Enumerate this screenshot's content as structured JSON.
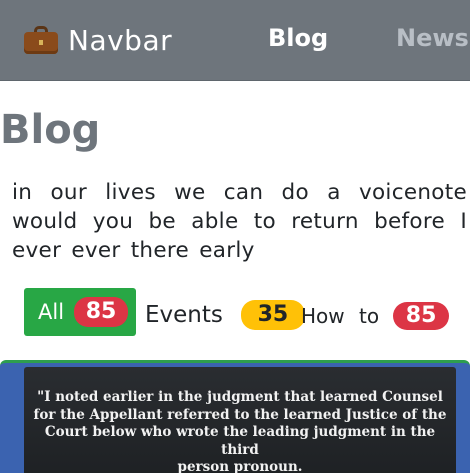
{
  "navbar": {
    "brand_icon": "briefcase-icon",
    "brand": "Navbar",
    "links": [
      {
        "label": "Blog",
        "active": true
      },
      {
        "label": "News",
        "active": false
      }
    ],
    "background": "#6e757c"
  },
  "page": {
    "title": "Blog",
    "intro": "in our lives we can do a voicenote would you be able to return before I ever ever there early"
  },
  "filters": [
    {
      "label": "All",
      "count": "85",
      "active": true,
      "badge_color": "#dc3545"
    },
    {
      "label": "Events",
      "count": "35",
      "active": false,
      "badge_color": "#ffc107"
    },
    {
      "label": "How to",
      "count": "85",
      "active": false,
      "badge_color": "#dc3545"
    }
  ],
  "post": {
    "quote_lines": [
      "\"I noted earlier in the judgment that learned Counsel",
      "for the Appellant referred to the learned Justice of the",
      "Court below who wrote the leading judgment in the third",
      "person pronoun."
    ]
  },
  "colors": {
    "accent_green": "#28a745",
    "badge_red": "#dc3545",
    "badge_yellow": "#ffc107",
    "card_blue": "#3b63b0"
  }
}
